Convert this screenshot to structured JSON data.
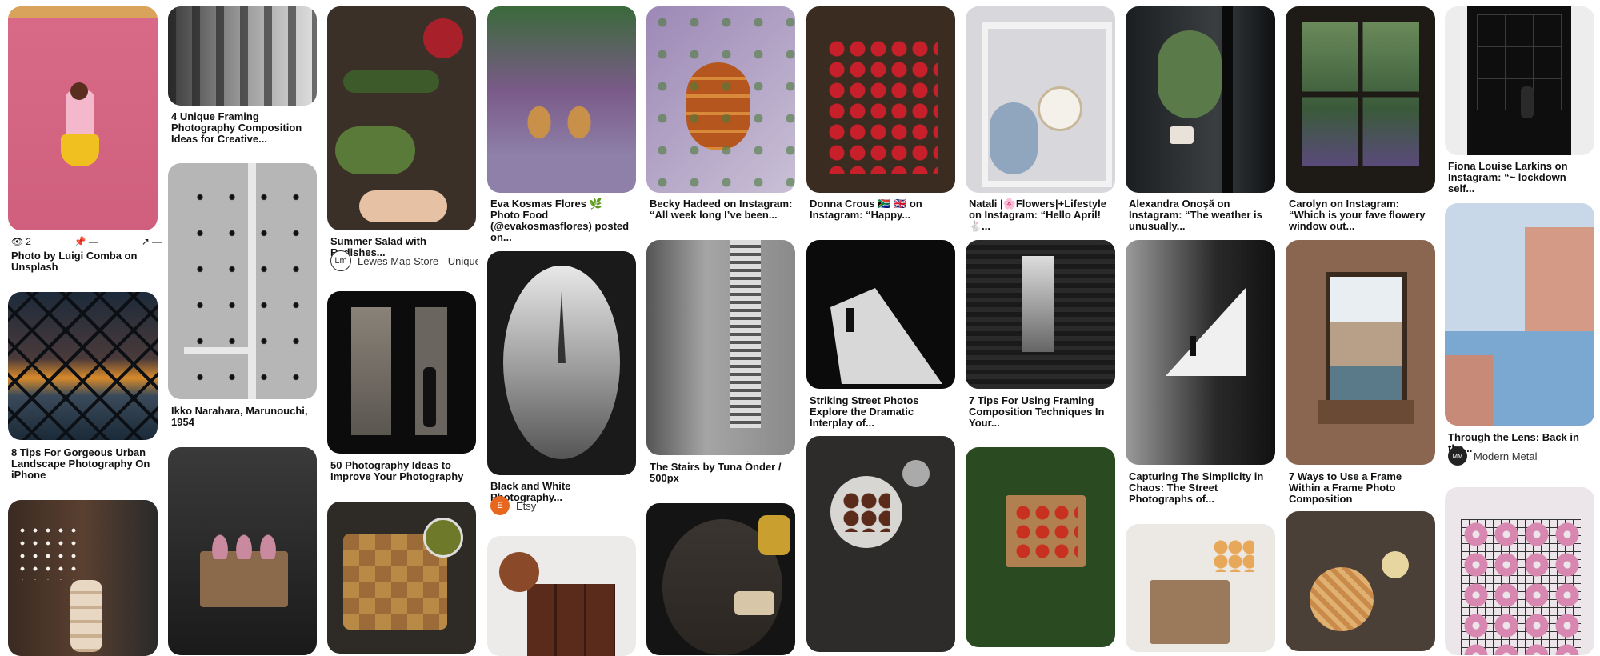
{
  "pins": [
    {
      "title": "Photo by Luigi Comba on Unsplash",
      "stats": {
        "views": "2",
        "saves": "—",
        "shares": "—"
      }
    },
    {
      "title": "8 Tips For Gorgeous Urban Landscape Photography On iPhone"
    },
    {
      "title": "4 Unique Framing Photography Composition Ideas for Creative..."
    },
    {
      "title": "Ikko Narahara, Marunouchi, 1954"
    },
    {
      "title": "Summer Salad with Radishes...",
      "source": "Lewes Map Store - Unique,..."
    },
    {
      "title": "50 Photography Ideas to Improve Your Photography"
    },
    {
      "title": "Eva Kosmas Flores 🌿 Photo Food (@evakosmasflores) posted on..."
    },
    {
      "title": "Black and White Photography...",
      "source": "Etsy"
    },
    {
      "title": "Becky Hadeed on Instagram: “All week long I’ve been..."
    },
    {
      "title": "The Stairs by Tuna Önder / 500px"
    },
    {
      "title": "Donna Crous 🇿🇦 🇬🇧 on Instagram: “Happy..."
    },
    {
      "title": "Striking Street Photos Explore the Dramatic Interplay of..."
    },
    {
      "title": "Natali |🌸Flowers|+Lifestyle on Instagram: “Hello April! 🐇..."
    },
    {
      "title": "7 Tips For Using Framing Composition Techniques In Your..."
    },
    {
      "title": "Alexandra Onoşă on Instagram: “The weather is unusually..."
    },
    {
      "title": "Capturing The Simplicity in Chaos: The Street Photographs of..."
    },
    {
      "title": "Carolyn on Instagram: “Which is your fave flowery window out..."
    },
    {
      "title": "7 Ways to Use a Frame Within a Frame Photo Composition"
    },
    {
      "title": "Fiona Louise Larkins on Instagram: “~ lockdown self..."
    },
    {
      "title": "Through the Lens: Back in the...",
      "source": "Modern Metal"
    }
  ],
  "icons": {
    "views": "eye-icon",
    "saves": "pin-icon",
    "shares": "share-arrow-icon"
  },
  "avatars": {
    "lewes": "Lm",
    "etsy": "E",
    "modern": "MM"
  },
  "colors": {
    "etsy": "#e8671f",
    "modern": "#222222",
    "lewes": "#ffffff"
  }
}
